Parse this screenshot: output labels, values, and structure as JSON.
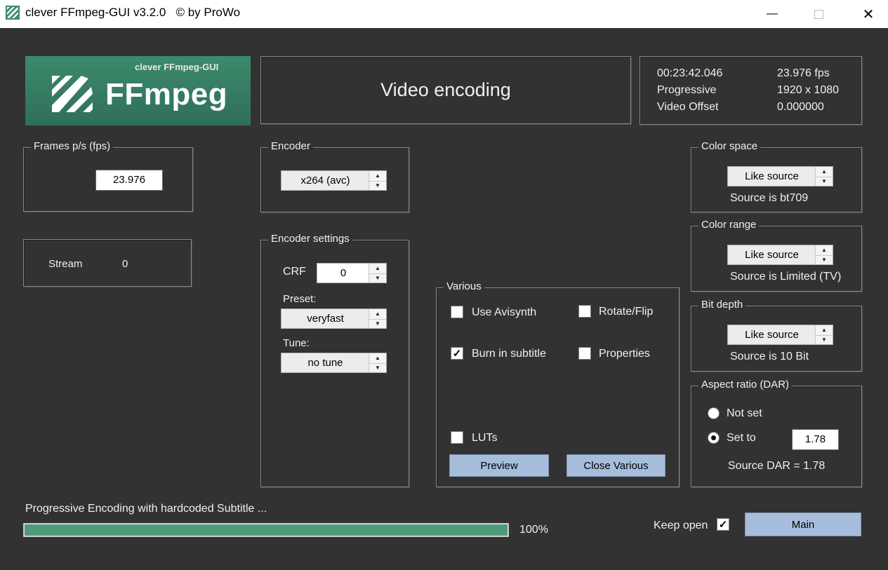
{
  "window": {
    "title": "clever FFmpeg-GUI v3.2.0   © by ProWo",
    "minimize_icon": "minimize-icon",
    "maximize_icon": "maximize-icon",
    "close_icon": "close-icon"
  },
  "logo": {
    "tagline": "clever FFmpeg-GUI",
    "name": "FFmpeg",
    "bg_color": "#3f8a6e"
  },
  "header": {
    "title": "Video encoding"
  },
  "info": {
    "duration": "00:23:42.046",
    "fps": "23.976 fps",
    "scan": "Progressive",
    "resolution": "1920 x 1080",
    "offset_label": "Video Offset",
    "offset_value": "0.000000"
  },
  "frames": {
    "legend": "Frames p/s (fps)",
    "value": "23.976"
  },
  "stream": {
    "label": "Stream",
    "value": "0"
  },
  "encoder": {
    "legend": "Encoder",
    "value": "x264 (avc)"
  },
  "encoder_settings": {
    "legend": "Encoder settings",
    "crf_label": "CRF",
    "crf_value": "0",
    "preset_label": "Preset:",
    "preset_value": "veryfast",
    "tune_label": "Tune:",
    "tune_value": "no tune"
  },
  "various": {
    "legend": "Various",
    "use_avisynth": "Use Avisynth",
    "use_avisynth_checked": false,
    "rotate_flip": "Rotate/Flip",
    "rotate_flip_checked": false,
    "burn_subtitle": "Burn in subtitle",
    "burn_subtitle_checked": true,
    "properties": "Properties",
    "properties_checked": false,
    "luts": "LUTs",
    "luts_checked": false,
    "preview_button": "Preview",
    "close_button": "Close Various"
  },
  "color_space": {
    "legend": "Color space",
    "value": "Like source",
    "note": "Source is bt709"
  },
  "color_range": {
    "legend": "Color range",
    "value": "Like source",
    "note": "Source is Limited (TV)"
  },
  "bit_depth": {
    "legend": "Bit depth",
    "value": "Like source",
    "note": "Source is 10 Bit"
  },
  "aspect": {
    "legend": "Aspect ratio (DAR)",
    "not_set": "Not set",
    "set_to": "Set to",
    "selected": "set_to",
    "value": "1.78",
    "source_dar": "Source DAR = 1.78"
  },
  "status": {
    "text": "Progressive Encoding with hardcoded Subtitle ...",
    "progress_percent": 100,
    "progress_label": "100%",
    "bar_color": "#4f9a7a"
  },
  "footer": {
    "keep_open": "Keep open",
    "keep_open_checked": true,
    "main_button": "Main"
  },
  "colors": {
    "background": "#323232",
    "button": "#a6bedb",
    "accent_green": "#3f8a6e"
  }
}
